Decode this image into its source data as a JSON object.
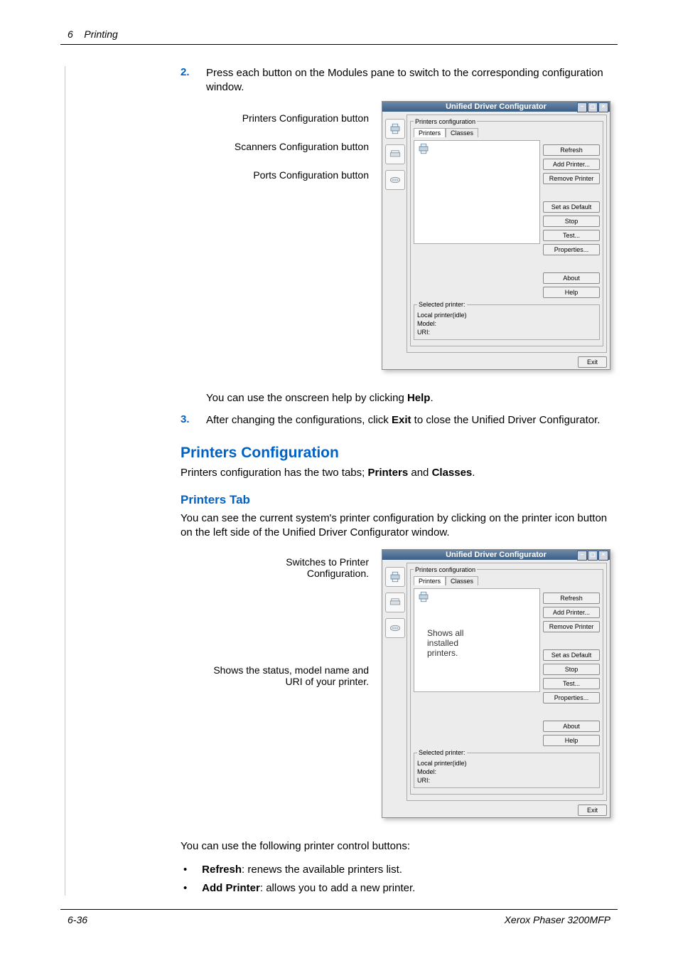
{
  "header": {
    "chapter_num": "6",
    "chapter_title": "Printing"
  },
  "steps": {
    "s2_num": "2.",
    "s2_text": "Press each button on the Modules pane to switch to the corresponding configuration window.",
    "s2_help_pre": "You can use the onscreen help by clicking ",
    "s2_help_bold": "Help",
    "s2_help_post": ".",
    "s3_num": "3.",
    "s3_pre": "After changing the configurations, click ",
    "s3_bold": "Exit",
    "s3_post": " to close the Unified Driver Configurator."
  },
  "callouts1": {
    "printers": "Printers Configuration button",
    "scanners": "Scanners Configuration button",
    "ports": "Ports Configuration button"
  },
  "section": {
    "printers_config": "Printers Configuration",
    "printers_config_desc_pre": "Printers configuration has the two tabs; ",
    "printers_bold": "Printers",
    "and_word": " and ",
    "classes_bold": "Classes",
    "printers_config_desc_post": ".",
    "printers_tab": "Printers Tab",
    "printers_tab_desc": "You can see the current system's printer configuration by clicking on the printer icon button on the left side of the Unified Driver Configurator window."
  },
  "callouts2": {
    "switches": "Switches to Printer Configuration.",
    "shows_all": "Shows all installed printers.",
    "shows_status": "Shows the status, model name and URI of your printer."
  },
  "after_fig": {
    "intro": "You can use the following printer control buttons:",
    "b1_bold": "Refresh",
    "b1_rest": ": renews the available printers list.",
    "b2_bold": "Add Printer",
    "b2_rest": ": allows you to add a new printer."
  },
  "udc": {
    "title": "Unified Driver Configurator",
    "group_legend": "Printers configuration",
    "tab_printers": "Printers",
    "tab_classes": "Classes",
    "btn_refresh": "Refresh",
    "btn_add": "Add Printer...",
    "btn_remove": "Remove Printer",
    "btn_default": "Set as Default",
    "btn_stop": "Stop",
    "btn_test": "Test...",
    "btn_props": "Properties...",
    "btn_about": "About",
    "btn_help": "Help",
    "sel_legend": "Selected printer:",
    "sel_line1": "Local printer(idle)",
    "sel_line2": "Model:",
    "sel_line3": "URI:",
    "exit": "Exit"
  },
  "footer": {
    "page": "6-36",
    "product": "Xerox Phaser 3200MFP"
  }
}
